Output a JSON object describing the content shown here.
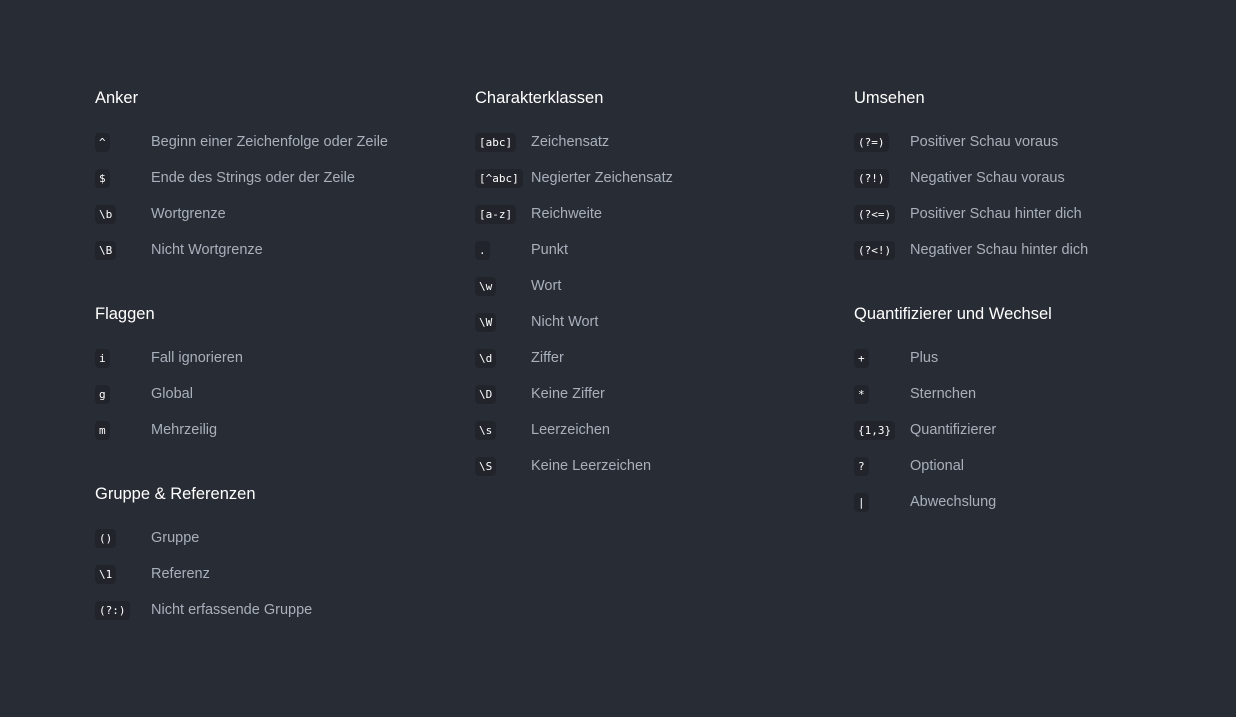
{
  "anchors": {
    "title": "Anker",
    "items": [
      {
        "code": "^",
        "label": "Beginn einer Zeichenfolge oder Zeile"
      },
      {
        "code": "$",
        "label": "Ende des Strings oder der Zeile"
      },
      {
        "code": "\\b",
        "label": "Wortgrenze"
      },
      {
        "code": "\\B",
        "label": "Nicht Wortgrenze"
      }
    ]
  },
  "flags": {
    "title": "Flaggen",
    "items": [
      {
        "code": "i",
        "label": "Fall ignorieren"
      },
      {
        "code": "g",
        "label": "Global"
      },
      {
        "code": "m",
        "label": "Mehrzeilig"
      }
    ]
  },
  "groups": {
    "title": "Gruppe & Referenzen",
    "items": [
      {
        "code": "()",
        "label": "Gruppe"
      },
      {
        "code": "\\1",
        "label": "Referenz"
      },
      {
        "code": "(?:)",
        "label": "Nicht erfassende Gruppe"
      }
    ]
  },
  "character_classes": {
    "title": "Charakterklassen",
    "items": [
      {
        "code": "[abc]",
        "label": "Zeichensatz"
      },
      {
        "code": "[^abc]",
        "label": "Negierter Zeichensatz"
      },
      {
        "code": "[a-z]",
        "label": "Reichweite"
      },
      {
        "code": ".",
        "label": "Punkt"
      },
      {
        "code": "\\w",
        "label": "Wort"
      },
      {
        "code": "\\W",
        "label": "Nicht Wort"
      },
      {
        "code": "\\d",
        "label": "Ziffer"
      },
      {
        "code": "\\D",
        "label": "Keine Ziffer"
      },
      {
        "code": "\\s",
        "label": "Leerzeichen"
      },
      {
        "code": "\\S",
        "label": "Keine Leerzeichen"
      }
    ]
  },
  "lookaround": {
    "title": "Umsehen",
    "items": [
      {
        "code": "(?=)",
        "label": "Positiver Schau voraus"
      },
      {
        "code": "(?!)",
        "label": "Negativer Schau voraus"
      },
      {
        "code": "(?<=)",
        "label": "Positiver Schau hinter dich"
      },
      {
        "code": "(?<!)",
        "label": "Negativer Schau hinter dich"
      }
    ]
  },
  "quantifiers": {
    "title": "Quantifizierer und Wechsel",
    "items": [
      {
        "code": "+",
        "label": "Plus"
      },
      {
        "code": "*",
        "label": "Sternchen"
      },
      {
        "code": "{1,3}",
        "label": "Quantifizierer"
      },
      {
        "code": "?",
        "label": "Optional"
      },
      {
        "code": "|",
        "label": "Abwechslung"
      }
    ]
  }
}
